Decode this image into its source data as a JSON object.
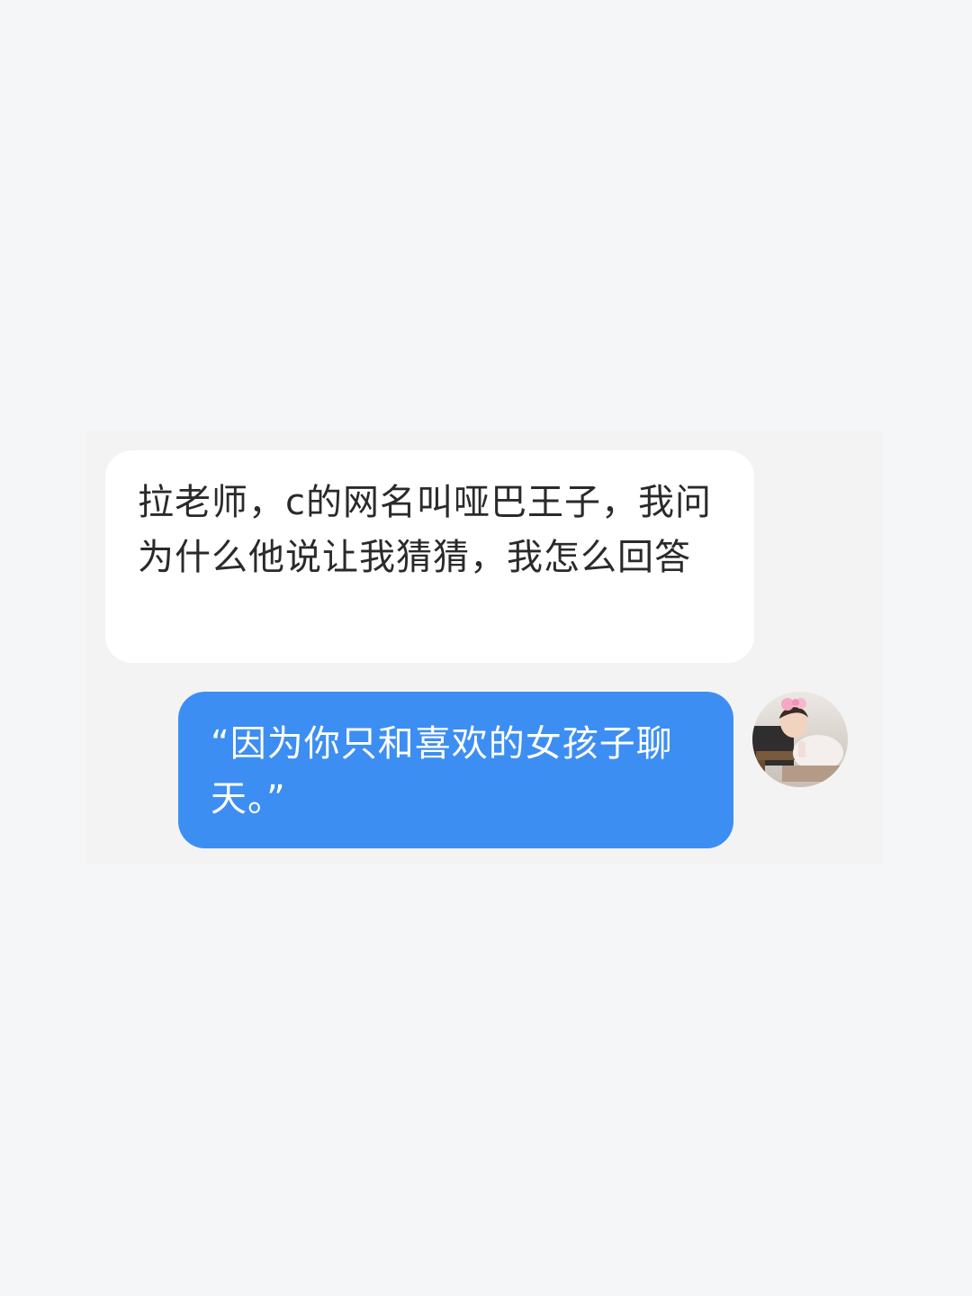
{
  "messages": [
    {
      "direction": "incoming",
      "text": "拉老师，c的网名叫哑巴王子，我问为什么他说让我猜猜，我怎么回答"
    },
    {
      "direction": "outgoing",
      "text": "“因为你只和喜欢的女孩子聊天。”"
    }
  ],
  "avatar": {
    "icon": "user-avatar-photo"
  },
  "colors": {
    "page_background": "#f5f6f8",
    "incoming_bubble": "#ffffff",
    "outgoing_bubble": "#3d8ef3",
    "incoming_text": "#2a2a2a",
    "outgoing_text": "#ffffff"
  }
}
